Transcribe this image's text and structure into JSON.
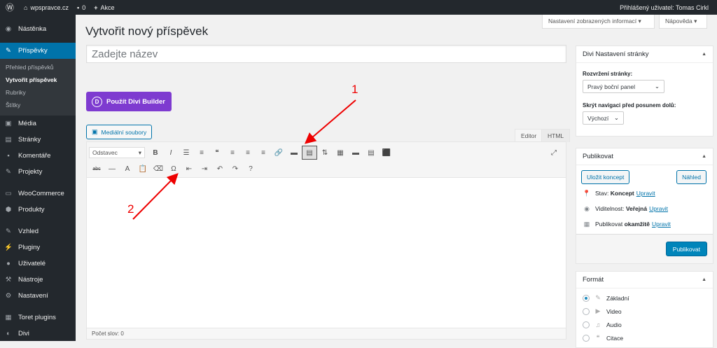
{
  "adminbar": {
    "site_name": "wpspravce.cz",
    "comments_count": "0",
    "new_label": "Akce",
    "user_greeting": "Přihlášený uživatel: Tomas Cirkl"
  },
  "sidebar": {
    "items_top": [
      {
        "label": "Nástěnka",
        "icon": "dashboard-icon",
        "glyph": "◉"
      }
    ],
    "active": {
      "label": "Příspěvky",
      "icon": "pin-icon",
      "glyph": "✎"
    },
    "submenu": [
      "Přehled příspěvků",
      "Vytvořit příspěvek",
      "Rubriky",
      "Štítky"
    ],
    "items_mid": [
      {
        "label": "Média",
        "icon": "media-icon",
        "glyph": "▣"
      },
      {
        "label": "Stránky",
        "icon": "pages-icon",
        "glyph": "▤"
      },
      {
        "label": "Komentáře",
        "icon": "comments-icon",
        "glyph": "▪"
      },
      {
        "label": "Projekty",
        "icon": "pin-icon",
        "glyph": "✎"
      }
    ],
    "items_woo": [
      {
        "label": "WooCommerce",
        "icon": "woocommerce-icon",
        "glyph": "▭"
      },
      {
        "label": "Produkty",
        "icon": "products-icon",
        "glyph": "⬢"
      }
    ],
    "items_bottom": [
      {
        "label": "Vzhled",
        "icon": "appearance-icon",
        "glyph": "✎"
      },
      {
        "label": "Pluginy",
        "icon": "plugins-icon",
        "glyph": "⚡"
      },
      {
        "label": "Uživatelé",
        "icon": "users-icon",
        "glyph": "●"
      },
      {
        "label": "Nástroje",
        "icon": "tools-icon",
        "glyph": "⚒"
      },
      {
        "label": "Nastavení",
        "icon": "settings-icon",
        "glyph": "⚙"
      }
    ],
    "items_end": [
      {
        "label": "Toret plugins",
        "icon": "toret-icon",
        "glyph": "▦"
      },
      {
        "label": "Divi",
        "icon": "divi-icon",
        "glyph": "◐"
      }
    ]
  },
  "header": {
    "screen_options": "Nastavení zobrazených informací ▾",
    "help": "Nápověda ▾",
    "page_title": "Vytvořit nový příspěvek"
  },
  "editor": {
    "title_placeholder": "Zadejte název",
    "divi_button": "Použít Divi Builder",
    "divi_logo": "D",
    "media_button": "Mediální soubory",
    "tab_visual": "Editor",
    "tab_html": "HTML",
    "format_select": "Odstavec",
    "word_count": "Počet slov: 0",
    "toolbar_row1": [
      {
        "name": "bold-button",
        "glyph": "B"
      },
      {
        "name": "italic-button",
        "glyph": "I"
      },
      {
        "name": "bullet-list-button",
        "glyph": "☰"
      },
      {
        "name": "numbered-list-button",
        "glyph": "≡"
      },
      {
        "name": "blockquote-button",
        "glyph": "❝"
      },
      {
        "name": "align-left-button",
        "glyph": "≡"
      },
      {
        "name": "align-center-button",
        "glyph": "≡"
      },
      {
        "name": "align-right-button",
        "glyph": "≡"
      },
      {
        "name": "link-button",
        "glyph": "🔗"
      },
      {
        "name": "read-more-button",
        "glyph": "▬"
      },
      {
        "name": "toolbar-toggle-button",
        "glyph": "▤",
        "selected": true
      },
      {
        "name": "shortcode-button",
        "glyph": "⇅"
      },
      {
        "name": "divi-layout-button",
        "glyph": "▦"
      },
      {
        "name": "divi-tabs-button",
        "glyph": "▬"
      },
      {
        "name": "divi-list-button",
        "glyph": "▤"
      },
      {
        "name": "divi-lock-button",
        "glyph": "⬛"
      }
    ],
    "toolbar_row2": [
      {
        "name": "strikethrough-button",
        "glyph": "abc"
      },
      {
        "name": "horizontal-line-button",
        "glyph": "—"
      },
      {
        "name": "text-color-button",
        "glyph": "A"
      },
      {
        "name": "paste-text-button",
        "glyph": "📋"
      },
      {
        "name": "clear-formatting-button",
        "glyph": "⌫"
      },
      {
        "name": "special-character-button",
        "glyph": "Ω"
      },
      {
        "name": "outdent-button",
        "glyph": "⇤"
      },
      {
        "name": "indent-button",
        "glyph": "⇥"
      },
      {
        "name": "undo-button",
        "glyph": "↶"
      },
      {
        "name": "redo-button",
        "glyph": "↷"
      },
      {
        "name": "help-button",
        "glyph": "?"
      }
    ]
  },
  "divi_settings": {
    "title": "Divi Nastavení stránky",
    "layout_label": "Rozvržení stránky:",
    "layout_value": "Pravý boční panel",
    "nav_label": "Skrýt navigaci před posunem dolů:",
    "nav_value": "Výchozí"
  },
  "publish": {
    "title": "Publikovat",
    "save_draft": "Uložit koncept",
    "preview": "Náhled",
    "status_label": "Stav:",
    "status_value": "Koncept",
    "visibility_label": "Viditelnost:",
    "visibility_value": "Veřejná",
    "publish_label": "Publikovat",
    "publish_value": "okamžitě",
    "edit": "Upravit",
    "publish_button": "Publikovat"
  },
  "format": {
    "title": "Formát",
    "options": [
      {
        "label": "Základní",
        "glyph": "✎",
        "icon": "pin-icon",
        "checked": true
      },
      {
        "label": "Video",
        "glyph": "▶",
        "icon": "video-icon",
        "checked": false
      },
      {
        "label": "Audio",
        "glyph": "♫",
        "icon": "audio-icon",
        "checked": false
      },
      {
        "label": "Citace",
        "glyph": "❝",
        "icon": "quote-icon",
        "checked": false
      }
    ]
  },
  "annotations": {
    "first": "1",
    "second": "2"
  },
  "colors": {
    "accent": "#0073aa",
    "divi": "#7e3bd0",
    "arrow": "#ee0000"
  }
}
